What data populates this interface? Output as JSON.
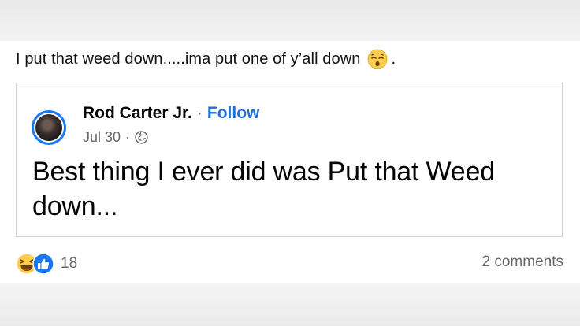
{
  "post": {
    "text": "I put that weed down.....ima put one of y’all down",
    "text_tail": ".",
    "emoji_icon": "dizzy-face-emoji-icon"
  },
  "shared": {
    "author": "Rod Carter Jr.",
    "separator": "·",
    "follow_label": "Follow",
    "date": "Jul 30",
    "privacy_icon": "globe-icon",
    "body": "Best thing I ever did was Put that Weed down..."
  },
  "footer": {
    "reaction_icons": [
      "haha-reaction-icon",
      "like-reaction-icon"
    ],
    "reaction_count": "18",
    "comments": "2 comments"
  },
  "colors": {
    "link_blue": "#216fdb",
    "like_blue": "#1877f2",
    "secondary_text": "#65676b",
    "card_border": "#cfd2d6"
  }
}
